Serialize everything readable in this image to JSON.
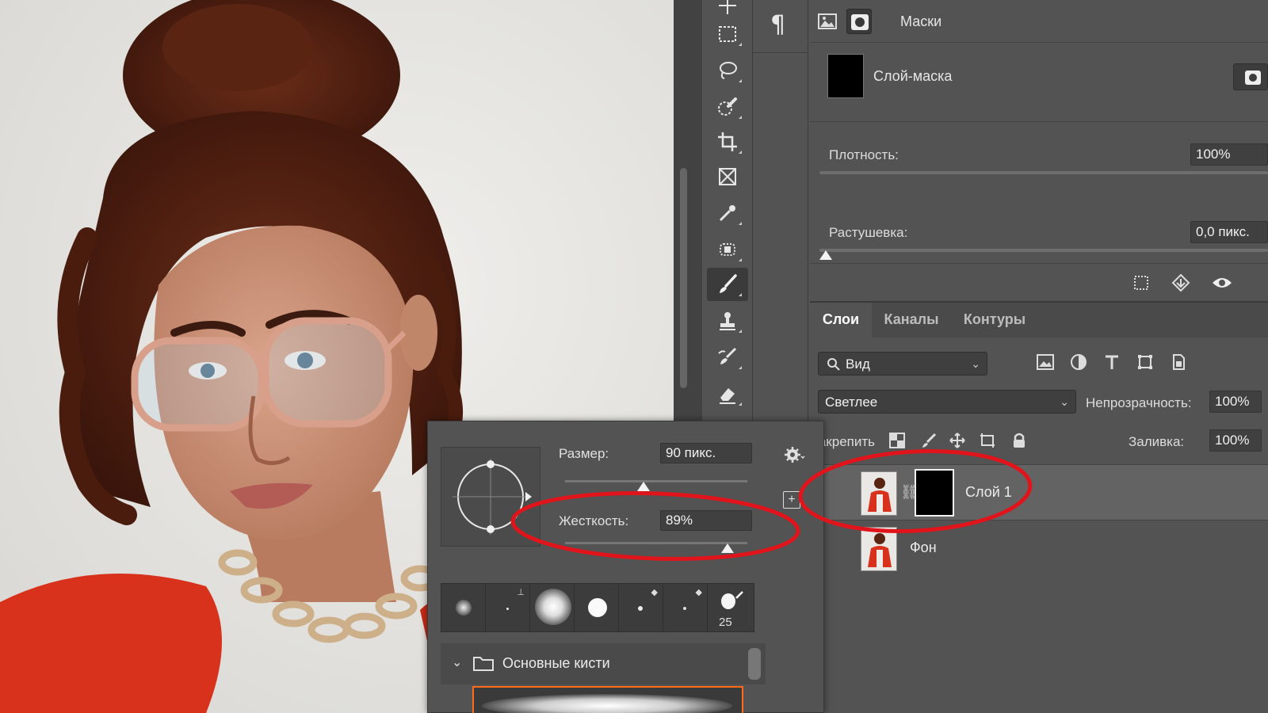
{
  "properties": {
    "title": "Маски",
    "mask_name": "Слой-маска",
    "density_label": "Плотность:",
    "density_value": "100%",
    "feather_label": "Растушевка:",
    "feather_value": "0,0 пикс.",
    "density_fraction": 1.0,
    "feather_fraction": 0.0
  },
  "layers_panel": {
    "tabs": [
      {
        "label": "Слои",
        "active": true
      },
      {
        "label": "Каналы",
        "active": false
      },
      {
        "label": "Контуры",
        "active": false
      }
    ],
    "filter_label": "Вид",
    "blend_mode": "Светлее",
    "opacity_label": "Непрозрачность:",
    "opacity_value": "100%",
    "lock_label": "Закрепить:",
    "fill_label": "Заливка:",
    "fill_value": "100%",
    "layers": [
      {
        "name": "Слой 1",
        "selected": true,
        "has_mask": true
      },
      {
        "name": "Фон",
        "selected": false,
        "has_mask": false
      }
    ]
  },
  "brush_popup": {
    "size_label": "Размер:",
    "size_value": "90 пикс.",
    "hardness_label": "Жесткость:",
    "hardness_value": "89%",
    "size_fraction": 0.43,
    "hardness_fraction": 0.89,
    "tip_number": "25",
    "folder_name": "Основные кисти"
  },
  "toolbar": {
    "active_tool": "brush-tool",
    "tools": [
      "move-tool",
      "marquee-tool",
      "lasso-tool",
      "quick-selection-tool",
      "crop-tool",
      "frame-tool",
      "eyedropper-tool",
      "spot-healing-tool",
      "brush-tool",
      "clone-stamp-tool",
      "history-brush-tool",
      "eraser-tool"
    ]
  },
  "colors": {
    "panel_bg": "#535353",
    "annotation_red": "#e0141a",
    "accent_orange": "#ff6b1a"
  }
}
